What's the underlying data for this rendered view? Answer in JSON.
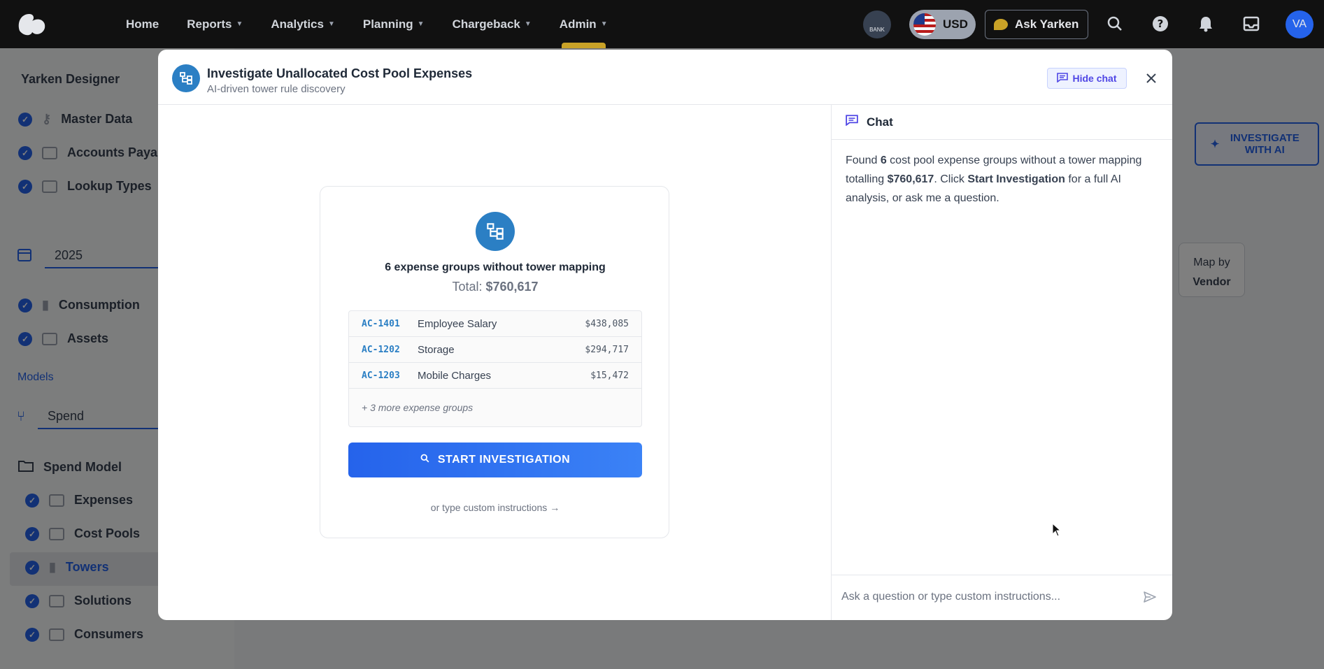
{
  "topnav": {
    "nav": [
      {
        "label": "Home",
        "dropdown": false
      },
      {
        "label": "Reports",
        "dropdown": true
      },
      {
        "label": "Analytics",
        "dropdown": true
      },
      {
        "label": "Planning",
        "dropdown": true
      },
      {
        "label": "Chargeback",
        "dropdown": true
      },
      {
        "label": "Admin",
        "dropdown": true,
        "active": true
      }
    ],
    "bank_label": "BANK",
    "currency": "USD",
    "ask_label": "Ask Yarken",
    "avatar": "VA",
    "icons": [
      "search-icon",
      "help-icon",
      "bell-icon",
      "inbox-icon"
    ]
  },
  "sidebar": {
    "title": "Yarken Designer",
    "top_items": [
      "Master Data",
      "Accounts Paya",
      "Lookup Types"
    ],
    "year": "2025",
    "data_items": [
      "Consumption",
      "Assets"
    ],
    "models_label": "Models",
    "model_value": "Spend",
    "spend_model": "Spend Model",
    "model_items": [
      "Expenses",
      "Cost Pools",
      "Towers",
      "Solutions",
      "Consumers"
    ],
    "selected": "Towers"
  },
  "background": {
    "investigate_label": "INVESTIGATE WITH AI",
    "map_by": "Map by",
    "map_value": "Vendor"
  },
  "modal": {
    "title": "Investigate Unallocated Cost Pool Expenses",
    "subtitle": "AI-driven tower rule discovery",
    "hide_chat": "Hide chat",
    "card": {
      "heading": "6 expense groups without tower mapping",
      "total_label": "Total:",
      "total_value": "$760,617",
      "rows": [
        {
          "code": "AC-1401",
          "name": "Employee Salary",
          "amount": "$438,085"
        },
        {
          "code": "AC-1202",
          "name": "Storage",
          "amount": "$294,717"
        },
        {
          "code": "AC-1203",
          "name": "Mobile Charges",
          "amount": "$15,472"
        }
      ],
      "more": "+ 3 more expense groups",
      "start_button": "START INVESTIGATION",
      "custom_link": "or type custom instructions →"
    },
    "chat": {
      "title": "Chat",
      "message_parts": {
        "p1": "Found ",
        "count": "6",
        "p2": " cost pool expense groups without a tower mapping totalling ",
        "total": "$760,617",
        "p3": ". Click ",
        "action": "Start Investigation",
        "p4": " for a full AI analysis, or ask me a question."
      },
      "placeholder": "Ask a question or type custom instructions..."
    }
  },
  "colors": {
    "nav_bg": "#111111",
    "accent": "#2563eb",
    "brand_gold": "#c9a227",
    "modal_icon": "#2b7fc4"
  }
}
